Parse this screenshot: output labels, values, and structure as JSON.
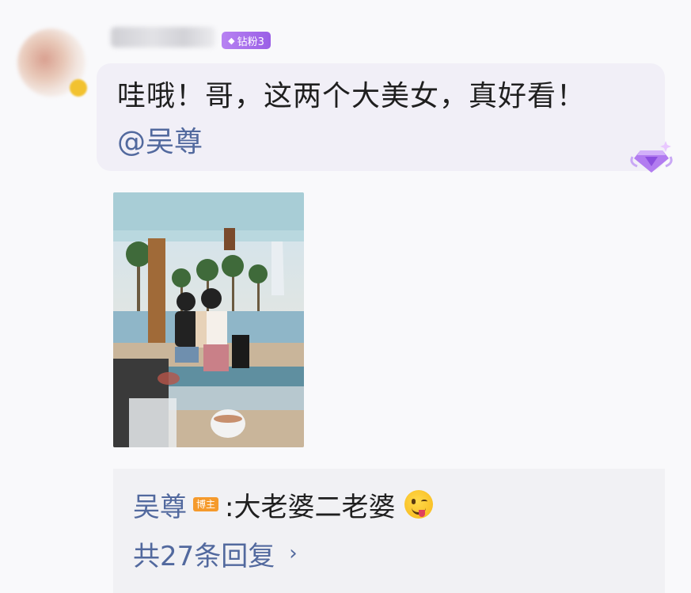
{
  "comment": {
    "username": "",
    "fan_badge": "钻粉3",
    "text": "哇哦！哥，这两个大美女，真好看！",
    "mention": "@吴尊"
  },
  "reply": {
    "author": "吴尊",
    "host_badge": "博主",
    "text": ":大老婆二老婆",
    "emoji": "zany-face-emoji"
  },
  "replies_summary": {
    "text": "共27条回复",
    "chevron": "›"
  },
  "colors": {
    "link": "#52699e",
    "fan_badge": "#a56ded",
    "host_badge": "#f59a2c"
  }
}
